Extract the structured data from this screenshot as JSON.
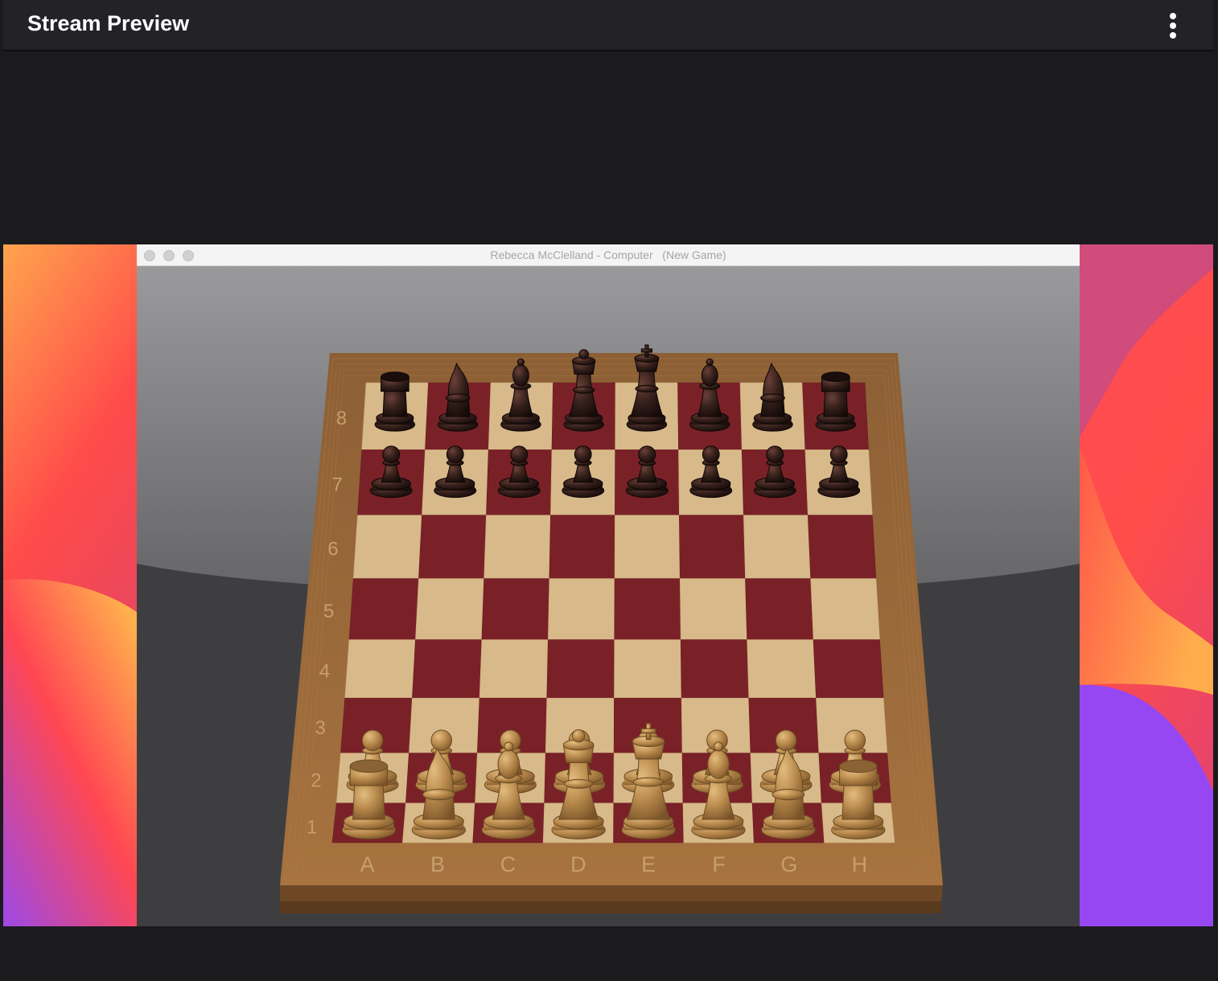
{
  "header": {
    "title": "Stream Preview",
    "menu_icon": "more-vertical-icon"
  },
  "chess_window": {
    "title": "Rebecca McClelland - Computer   (New Game)",
    "files": [
      "A",
      "B",
      "C",
      "D",
      "E",
      "F",
      "G",
      "H"
    ],
    "ranks": [
      "1",
      "2",
      "3",
      "4",
      "5",
      "6",
      "7",
      "8"
    ],
    "position": {
      "rank8": [
        "rook",
        "knight",
        "bishop",
        "queen",
        "king",
        "bishop",
        "knight",
        "rook"
      ],
      "rank7": [
        "pawn",
        "pawn",
        "pawn",
        "pawn",
        "pawn",
        "pawn",
        "pawn",
        "pawn"
      ],
      "rank2": [
        "pawn",
        "pawn",
        "pawn",
        "pawn",
        "pawn",
        "pawn",
        "pawn",
        "pawn"
      ],
      "rank1": [
        "rook",
        "knight",
        "bishop",
        "queen",
        "king",
        "bishop",
        "knight",
        "rook"
      ]
    }
  },
  "colors": {
    "dark_square": "#7a2128",
    "light_square": "#d8b98a",
    "frame_wood": "#9a6a3c",
    "dark_piece": "#2a1614",
    "light_piece": "#b88a4e"
  }
}
